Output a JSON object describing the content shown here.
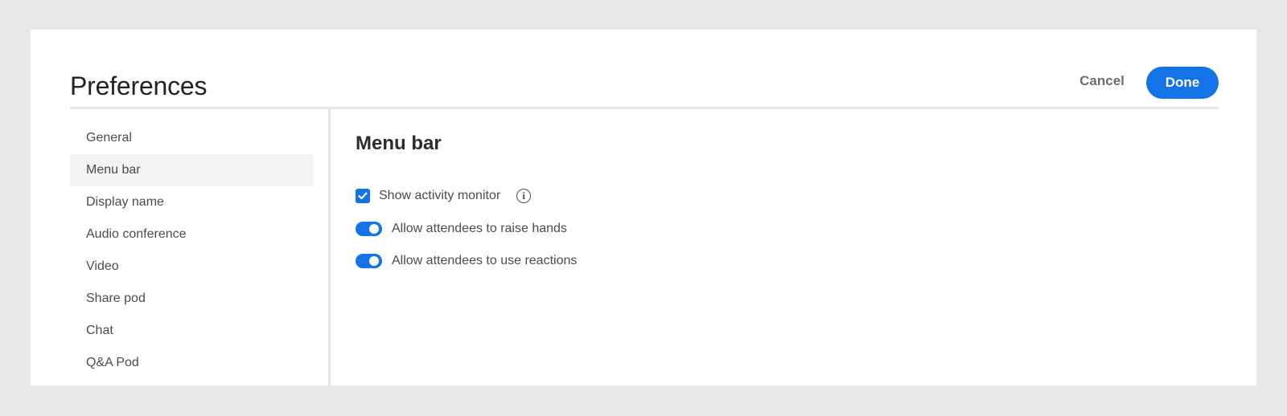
{
  "header": {
    "title": "Preferences",
    "cancel_label": "Cancel",
    "done_label": "Done"
  },
  "sidebar": {
    "items": [
      {
        "label": "General",
        "active": false
      },
      {
        "label": "Menu bar",
        "active": true
      },
      {
        "label": "Display name",
        "active": false
      },
      {
        "label": "Audio conference",
        "active": false
      },
      {
        "label": "Video",
        "active": false
      },
      {
        "label": "Share pod",
        "active": false
      },
      {
        "label": "Chat",
        "active": false
      },
      {
        "label": "Q&A Pod",
        "active": false
      }
    ]
  },
  "main": {
    "section_title": "Menu bar",
    "options": [
      {
        "type": "checkbox",
        "label": "Show activity monitor",
        "checked": true,
        "icon": "info-icon",
        "icon_glyph": "i"
      },
      {
        "type": "toggle",
        "label": "Allow attendees to raise hands",
        "on": true
      },
      {
        "type": "toggle",
        "label": "Allow attendees to use reactions",
        "on": true
      }
    ]
  },
  "colors": {
    "accent": "#1473e6",
    "background": "#e8e8e8",
    "panel": "#ffffff",
    "active_item": "#f2f2f2"
  }
}
